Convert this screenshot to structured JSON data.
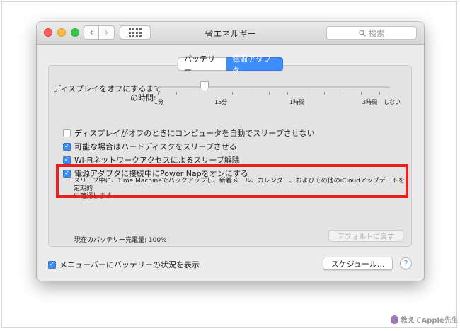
{
  "window": {
    "title": "省エネルギー",
    "search_placeholder": "検索"
  },
  "tabs": [
    {
      "label": "バッテリー",
      "selected": false
    },
    {
      "label": "電源アダプタ",
      "selected": true
    }
  ],
  "display_sleep": {
    "label_line1": "ディスプレイをオフにするまで",
    "label_line2": "の時間:",
    "ticks": [
      "1分",
      "15分",
      "1時間",
      "3時間",
      "しない"
    ],
    "value": "15分"
  },
  "options": [
    {
      "label": "ディスプレイがオフのときにコンピュータを自動でスリープさせない",
      "checked": false
    },
    {
      "label": "可能な場合はハードディスクをスリープさせる",
      "checked": true
    },
    {
      "label": "Wi-Fiネットワークアクセスによるスリープ解除",
      "checked": true
    },
    {
      "label": "電源アダプタに接続中にPower Napをオンにする",
      "checked": true
    }
  ],
  "power_nap_description_line1": "スリープ中に、Time Machineでバックアップし、新着メール、カレンダー、およびその他のiCloudアップデートを定期的",
  "power_nap_description_line2": "に確認します",
  "battery_status": "現在のバッテリー充電量: 100%",
  "buttons": {
    "default": "デフォルトに戻す",
    "schedule": "スケジュール...",
    "help": "?"
  },
  "menubar_option": {
    "label": "メニューバーにバッテリーの状況を表示",
    "checked": true
  },
  "colors": {
    "accent": "#3d8ef8",
    "highlight": "#ea1f1f"
  },
  "watermark": "教えてApple先生"
}
